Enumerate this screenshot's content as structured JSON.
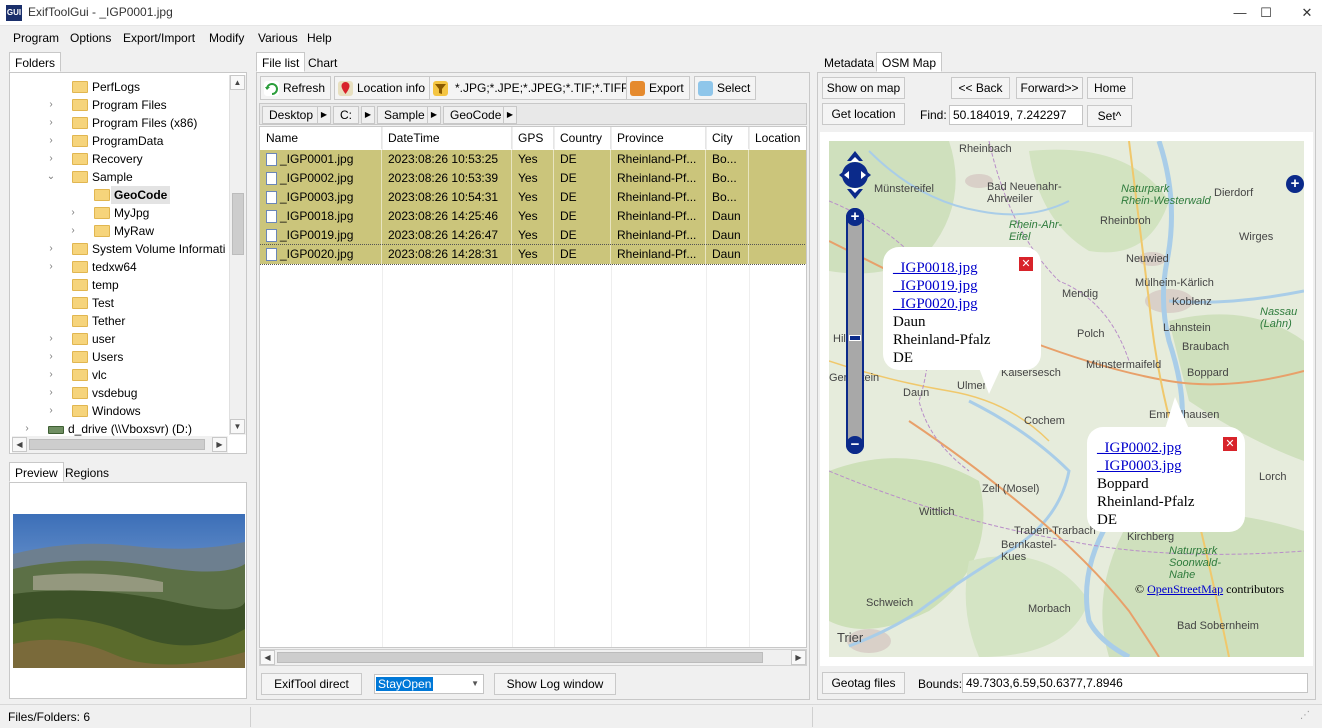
{
  "window": {
    "title": "ExifToolGui - _IGP0001.jpg",
    "icon_text": "GUI",
    "minimize": "—",
    "maximize": "☐",
    "close": "✕"
  },
  "menu": [
    "Program",
    "Options",
    "Export/Import",
    "Modify",
    "Various",
    "Help"
  ],
  "left": {
    "tab_folders": "Folders",
    "tree": [
      {
        "label": "PerfLogs"
      },
      {
        "label": "Program Files"
      },
      {
        "label": "Program Files (x86)"
      },
      {
        "label": "ProgramData"
      },
      {
        "label": "Recovery"
      },
      {
        "label": "Sample"
      },
      {
        "label": "GeoCode"
      },
      {
        "label": "MyJpg"
      },
      {
        "label": "MyRaw"
      },
      {
        "label": "System Volume Informati"
      },
      {
        "label": "tedxw64"
      },
      {
        "label": "temp"
      },
      {
        "label": "Test"
      },
      {
        "label": "Tether"
      },
      {
        "label": "user"
      },
      {
        "label": "Users"
      },
      {
        "label": "vlc"
      },
      {
        "label": "vsdebug"
      },
      {
        "label": "Windows"
      },
      {
        "label": "d_drive (\\\\Vboxsvr) (D:)"
      }
    ],
    "tab_preview": "Preview",
    "tab_regions": "Regions"
  },
  "middle": {
    "tab_filelist": "File list",
    "tab_chart": "Chart",
    "toolbar": {
      "refresh": "Refresh",
      "location_info": "Location info",
      "filter": "*.JPG;*.JPE;*.JPEG;*.TIF;*.TIFF",
      "export": "Export",
      "select": "Select"
    },
    "breadcrumb": [
      "Desktop",
      "C:",
      "Sample",
      "GeoCode"
    ],
    "columns": [
      "Name",
      "DateTime",
      "GPS",
      "Country",
      "Province",
      "City",
      "Location"
    ],
    "rows": [
      {
        "name": "_IGP0001.jpg",
        "datetime": "2023:08:26 10:53:25",
        "gps": "Yes",
        "country": "DE",
        "province": "Rheinland-Pf...",
        "city": "Bo..."
      },
      {
        "name": "_IGP0002.jpg",
        "datetime": "2023:08:26 10:53:39",
        "gps": "Yes",
        "country": "DE",
        "province": "Rheinland-Pf...",
        "city": "Bo..."
      },
      {
        "name": "_IGP0003.jpg",
        "datetime": "2023:08:26 10:54:31",
        "gps": "Yes",
        "country": "DE",
        "province": "Rheinland-Pf...",
        "city": "Bo..."
      },
      {
        "name": "_IGP0018.jpg",
        "datetime": "2023:08:26 14:25:46",
        "gps": "Yes",
        "country": "DE",
        "province": "Rheinland-Pf...",
        "city": "Daun"
      },
      {
        "name": "_IGP0019.jpg",
        "datetime": "2023:08:26 14:26:47",
        "gps": "Yes",
        "country": "DE",
        "province": "Rheinland-Pf...",
        "city": "Daun"
      },
      {
        "name": "_IGP0020.jpg",
        "datetime": "2023:08:26 14:28:31",
        "gps": "Yes",
        "country": "DE",
        "province": "Rheinland-Pf...",
        "city": "Daun"
      }
    ],
    "exiftool_direct": "ExifTool direct",
    "stayopen": "StayOpen",
    "show_log": "Show Log window"
  },
  "right": {
    "tab_metadata": "Metadata",
    "tab_osm": "OSM Map",
    "show_on_map": "Show on map",
    "back": "<< Back",
    "forward": "Forward>>",
    "home": "Home",
    "get_location": "Get location",
    "find_label": "Find:",
    "find_value": "50.184019, 7.242297",
    "set": "Set^",
    "map_labels": [
      "Rheinbach",
      "Münstereifel",
      "Bad Neuenahr-\nAhrweiler",
      "Naturpark\nRhein-Westerwald",
      "Dierdorf",
      "Rheinbroh",
      "Rhein-Ahr-\nEifel",
      "Wirges",
      "Neuwied",
      "Mülheim-Kärlich",
      "Mendig",
      "Koblenz",
      "Polch",
      "Lahnstein",
      "Nassau\n(Lahn)",
      "Braubach",
      "Ulmen",
      "Kaisersesch",
      "Münstermaifeld",
      "Boppard",
      "Daun",
      "Gerolstein",
      "Cochem",
      "Emmelhausen",
      "Lorch",
      "Zell (Mosel)",
      "Wittlich",
      "Traben-Trarbach",
      "Bernkastel-\nKues",
      "Kirchberg",
      "Naturpark\nSoonwald-\nNahe",
      "Schweich",
      "Morbach",
      "Trier",
      "Bad Sobernheim",
      "Hill"
    ],
    "popup1": {
      "links": [
        "_IGP0018.jpg",
        "_IGP0019.jpg",
        "_IGP0020.jpg"
      ],
      "lines": [
        "Daun",
        "Rheinland-Pfalz",
        "DE"
      ]
    },
    "popup2": {
      "links": [
        "_IGP0002.jpg",
        "_IGP0003.jpg"
      ],
      "lines": [
        "Boppard",
        "Rheinland-Pfalz",
        "DE"
      ]
    },
    "attribution_prefix": "©",
    "attribution_link": "OpenStreetMap",
    "attribution_suffix": "contributors",
    "geotag": "Geotag files",
    "bounds_label": "Bounds:",
    "bounds_value": "49.7303,6.59,50.6377,7.8946"
  },
  "status": {
    "files_folders": "Files/Folders: 6"
  },
  "colors": {
    "selection_row": "#cbc57b",
    "link": "#0000cc",
    "map_bg": "#e8ede0",
    "water": "#a9cde8"
  }
}
